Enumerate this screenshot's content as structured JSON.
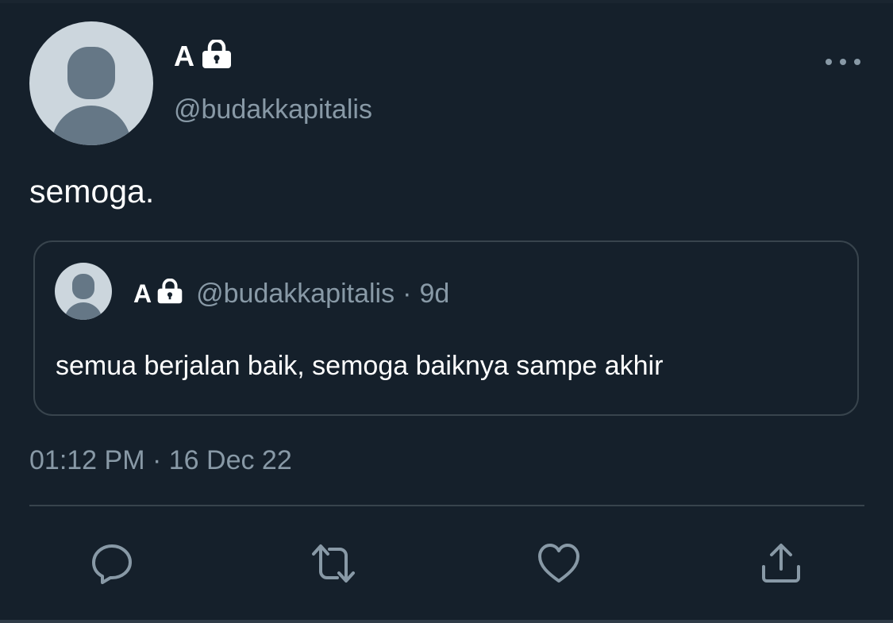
{
  "tweet": {
    "display_name": "A",
    "handle": "@budakkapitalis",
    "text": "semoga.",
    "timestamp": "01:12 PM · 16 Dec 22",
    "locked_icon": "lock-icon",
    "more_icon": "more-horizontal-icon"
  },
  "quoted_tweet": {
    "display_name": "A",
    "handle": "@budakkapitalis",
    "separator": "·",
    "relative_time": "9d",
    "text": "semua berjalan baik, semoga baiknya sampe akhir"
  },
  "actions": [
    {
      "icon": "reply-icon"
    },
    {
      "icon": "retweet-icon"
    },
    {
      "icon": "like-icon"
    },
    {
      "icon": "share-icon"
    }
  ],
  "colors": {
    "background": "#15202b",
    "secondary_text": "#8899a6",
    "border": "#38444d",
    "primary_text": "#ffffff"
  }
}
